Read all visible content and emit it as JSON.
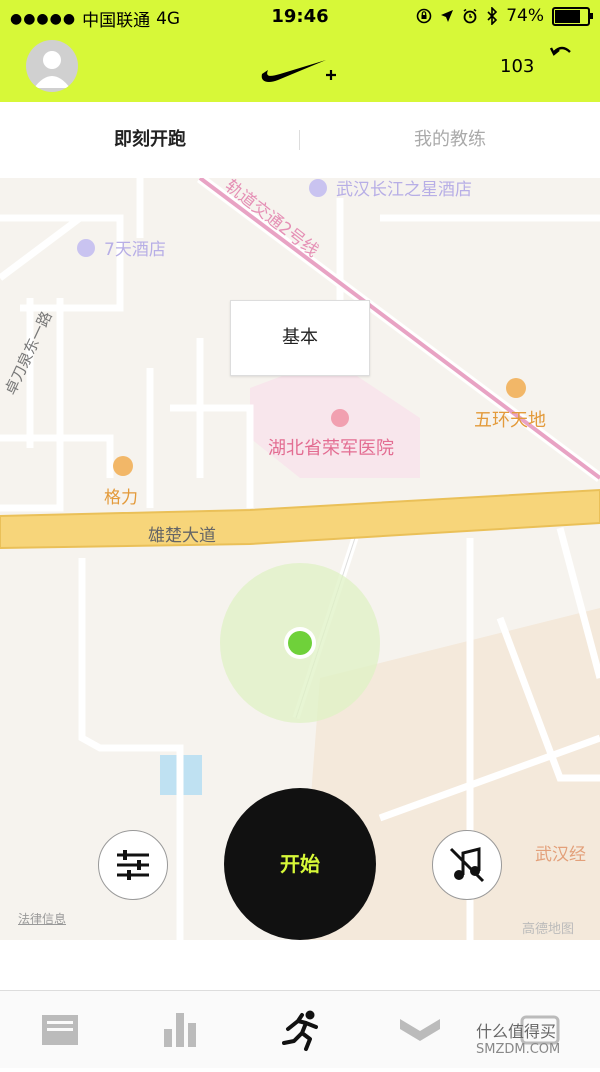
{
  "status_bar": {
    "signal": "●●●●●",
    "carrier": "中国联通",
    "network": "4G",
    "time": "19:46",
    "battery_percent": "74%",
    "battery_level": 0.74
  },
  "header": {
    "steps": "103",
    "avatar_icon": "avatar-icon",
    "logo_icon": "nike-plus-logo",
    "back_icon": "undo-arrow-icon"
  },
  "tabs": [
    {
      "label": "即刻开跑",
      "active": true
    },
    {
      "label": "我的教练",
      "active": false
    }
  ],
  "map": {
    "mode_button": "基本",
    "legal_link": "法律信息",
    "provider": "高德地图",
    "labels": {
      "hotel_star": "武汉长江之星酒店",
      "metro_line": "轨道交通2号线",
      "hotel_7days": "7天酒店",
      "road_zhuodaoquan": "卓刀泉东一路",
      "hospital": "湖北省荣军医院",
      "wuhuan": "五环天地",
      "geli": "格力",
      "xiongchu": "雄楚大道",
      "wuhan_partial": "武汉经"
    }
  },
  "controls": {
    "settings_icon": "sliders-icon",
    "start_label": "开始",
    "music_icon": "music-off-icon"
  },
  "bottom_nav": [
    {
      "icon": "feed-icon"
    },
    {
      "icon": "stats-icon"
    },
    {
      "icon": "runner-icon",
      "active": true
    },
    {
      "icon": "chevron-down-icon"
    },
    {
      "icon": "shoe-icon"
    }
  ],
  "watermark": {
    "title": "什么值得买",
    "domain": "SMZDM.COM"
  }
}
